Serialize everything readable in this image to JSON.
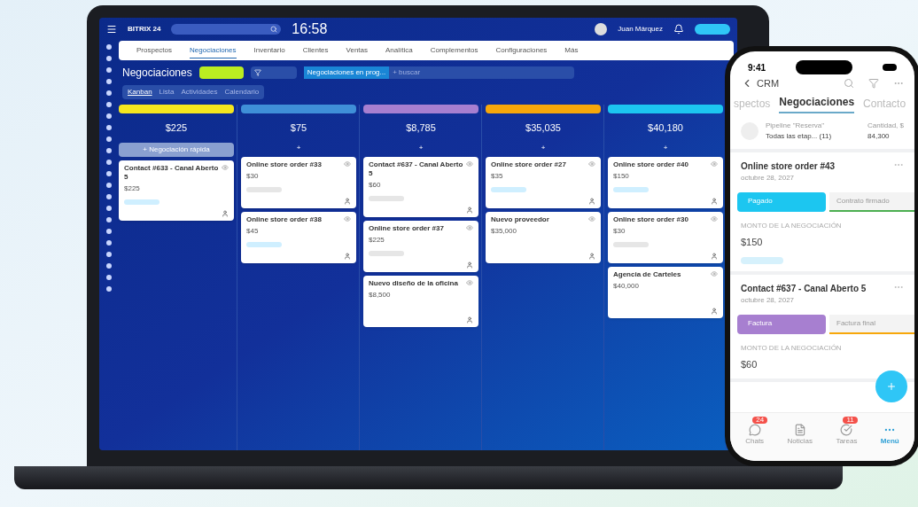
{
  "laptop": {
    "brand": "BITRIX 24",
    "clock": "16:58",
    "user": "Juan Márquez",
    "nav_tabs": [
      {
        "label": "Prospectos",
        "selected": false
      },
      {
        "label": "Negociaciones",
        "selected": true
      },
      {
        "label": "Inventario",
        "selected": false
      },
      {
        "label": "Clientes",
        "selected": false
      },
      {
        "label": "Ventas",
        "selected": false
      },
      {
        "label": "Analítica",
        "selected": false
      },
      {
        "label": "Complementos",
        "selected": false
      },
      {
        "label": "Configuraciones",
        "selected": false
      },
      {
        "label": "Más",
        "selected": false
      }
    ],
    "page_title": "Negociaciones",
    "filter_chip": "Negociaciones en prog...",
    "search_placeholder": "+ buscar",
    "view_tabs": [
      {
        "label": "Kanban",
        "selected": true
      },
      {
        "label": "Lista",
        "selected": false
      },
      {
        "label": "Actividades",
        "selected": false
      },
      {
        "label": "Calendario",
        "selected": false
      }
    ],
    "columns": [
      {
        "color": "#f5e61e",
        "total": "$225",
        "add_label": "+ Negociación rápida",
        "cards": [
          {
            "title": "Contact #633 - Canal Aberto 5",
            "amount": "$225",
            "color": "#cfefff"
          }
        ]
      },
      {
        "color": "#3f8fd8",
        "total": "$75",
        "add_label": "+",
        "cards": [
          {
            "title": "Online store order #33",
            "amount": "$30",
            "color": "#e6e6e6"
          },
          {
            "title": "Online store order #38",
            "amount": "$45",
            "color": "#cfefff"
          }
        ]
      },
      {
        "color": "#a77fd0",
        "total": "$8,785",
        "add_label": "+",
        "cards": [
          {
            "title": "Contact #637 - Canal Aberto 5",
            "amount": "$60",
            "color": "#e6e6e6"
          },
          {
            "title": "Online store order #37",
            "amount": "$225",
            "color": "#e6e6e6"
          },
          {
            "title": "Nuevo diseño de la oficina",
            "amount": "$8,500"
          }
        ]
      },
      {
        "color": "#f7a70a",
        "total": "$35,035",
        "add_label": "+",
        "cards": [
          {
            "title": "Online store order #27",
            "amount": "$35",
            "color": "#cfefff"
          },
          {
            "title": "Nuevo proveedor",
            "amount": "$35,000"
          }
        ]
      },
      {
        "color": "#1cc6f0",
        "total": "$40,180",
        "add_label": "+",
        "cards": [
          {
            "title": "Online store order #40",
            "amount": "$150",
            "color": "#cfefff"
          },
          {
            "title": "Online store order #30",
            "amount": "$30",
            "color": "#e6e6e6"
          },
          {
            "title": "Agencia de Carteles",
            "amount": "$40,000"
          }
        ]
      }
    ]
  },
  "phone": {
    "time": "9:41",
    "back_label": "CRM",
    "tabs": [
      {
        "label": "spectos",
        "selected": false
      },
      {
        "label": "Negociaciones",
        "selected": true
      },
      {
        "label": "Contacto",
        "selected": false
      }
    ],
    "pipeline_label": "Pipeline \"Reserva\"",
    "pipeline_value": "Todas las etap... (11)",
    "sum_label": "Cantidad, $",
    "sum_value": "84,300",
    "deals": [
      {
        "title": "Online store order #43",
        "date": "octubre 28, 2027",
        "stages": [
          {
            "label": "Pagado",
            "color": "#1cc6f0",
            "kind": "current"
          },
          {
            "label": "Contrato firmado",
            "color": "#4caf50",
            "kind": "next"
          }
        ],
        "amount_label": "MONTO DE LA NEGOCIACIÓN",
        "amount": "$150",
        "tag": true
      },
      {
        "title": "Contact #637 - Canal Aberto 5",
        "date": "octubre 28, 2027",
        "stages": [
          {
            "label": "Factura",
            "color": "#a77fd0",
            "kind": "current"
          },
          {
            "label": "Factura final",
            "color": "#f7a70a",
            "kind": "next"
          }
        ],
        "amount_label": "MONTO DE LA NEGOCIACIÓN",
        "amount": "$60",
        "tag": false
      }
    ],
    "bottom_tabs": [
      {
        "label": "Chats",
        "badge": "24",
        "selected": false
      },
      {
        "label": "Noticias",
        "selected": false
      },
      {
        "label": "Tareas",
        "badge": "11",
        "selected": false
      },
      {
        "label": "Menú",
        "selected": true
      }
    ]
  }
}
